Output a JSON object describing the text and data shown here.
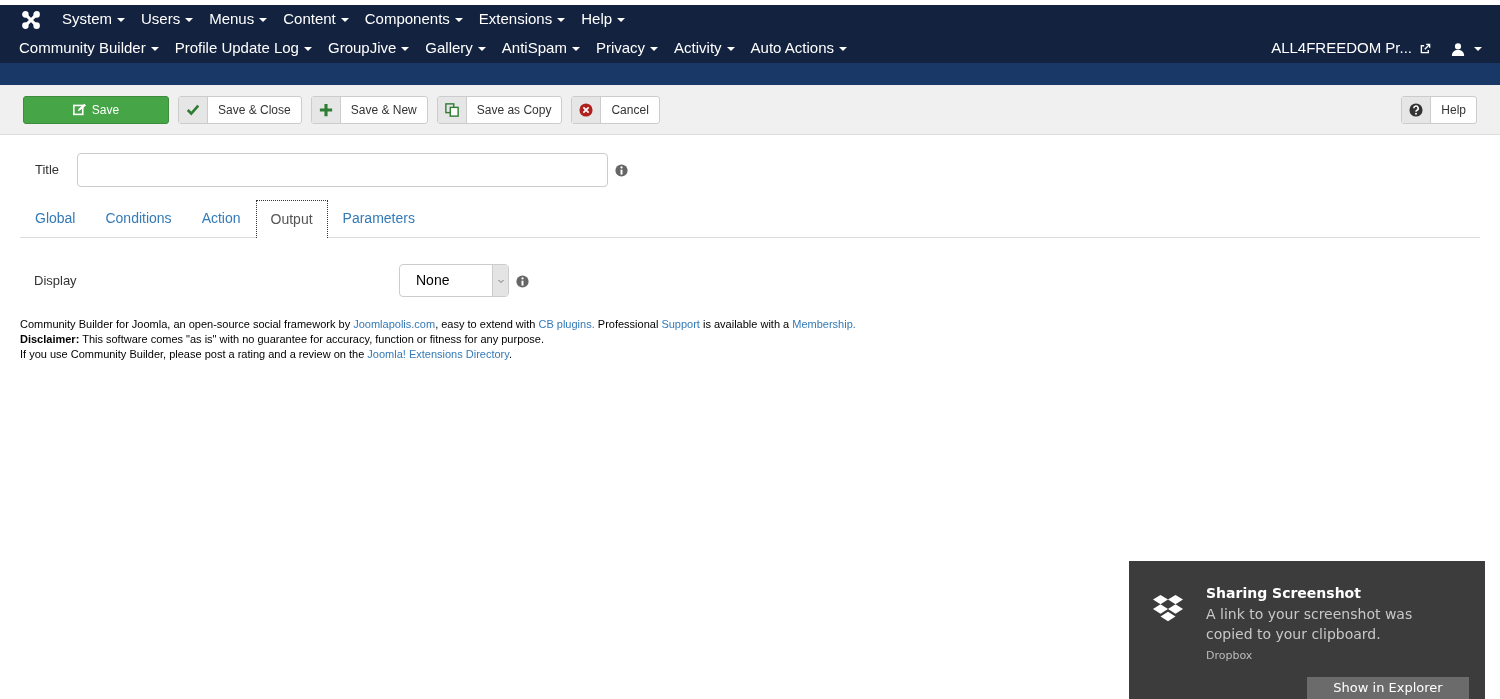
{
  "navbar": {
    "menu_row_1": [
      {
        "label": "System"
      },
      {
        "label": "Users"
      },
      {
        "label": "Menus"
      },
      {
        "label": "Content"
      },
      {
        "label": "Components"
      },
      {
        "label": "Extensions"
      },
      {
        "label": "Help"
      }
    ],
    "menu_row_2": [
      {
        "label": "Community Builder"
      },
      {
        "label": "Profile Update Log"
      },
      {
        "label": "GroupJive"
      },
      {
        "label": "Gallery"
      },
      {
        "label": "AntiSpam"
      },
      {
        "label": "Privacy"
      },
      {
        "label": "Activity"
      },
      {
        "label": "Auto Actions"
      }
    ],
    "site_link": "ALL4FREEDOM Pr..."
  },
  "toolbar": {
    "buttons": [
      {
        "label": "Save",
        "kind": "save"
      },
      {
        "label": "Save & Close",
        "kind": "check"
      },
      {
        "label": "Save & New",
        "kind": "plus"
      },
      {
        "label": "Save as Copy",
        "kind": "copy"
      },
      {
        "label": "Cancel",
        "kind": "cancel"
      }
    ],
    "help_button": {
      "label": "Help",
      "kind": "help"
    }
  },
  "form": {
    "title_label": "Title",
    "tabs": [
      {
        "label": "Global",
        "selected": false
      },
      {
        "label": "Conditions",
        "selected": false
      },
      {
        "label": "Action",
        "selected": false
      },
      {
        "label": "Output",
        "selected": true
      },
      {
        "label": "Parameters",
        "selected": false
      }
    ],
    "display_label": "Display",
    "display_value": "None"
  },
  "footer": [
    [
      {
        "text": "Community Builder for Joomla, an open-source social framework by ",
        "link": false
      },
      {
        "text": "Joomlapolis.com",
        "link": true
      },
      {
        "text": ", easy to extend with ",
        "link": false
      },
      {
        "text": "CB plugins.",
        "link": true
      },
      {
        "text": " Professional ",
        "link": false
      },
      {
        "text": "Support",
        "link": true
      },
      {
        "text": " is available with a ",
        "link": false
      },
      {
        "text": "Membership.",
        "link": true
      }
    ],
    [
      {
        "text": "**Disclaimer:** This software comes \"as is\" with no guarantee for accuracy, function or fitness for any purpose.",
        "link": false
      }
    ],
    [
      {
        "text": "If you use Community Builder, please post a rating and a review on the ",
        "link": false
      },
      {
        "text": "Joomla! Extensions Directory",
        "link": true
      },
      {
        "text": ".",
        "link": false
      }
    ]
  ],
  "notification": {
    "title": "Sharing Screenshot",
    "message": "A link to your screenshot was copied to your clipboard.",
    "source": "Dropbox",
    "button": "Show in Explorer"
  }
}
